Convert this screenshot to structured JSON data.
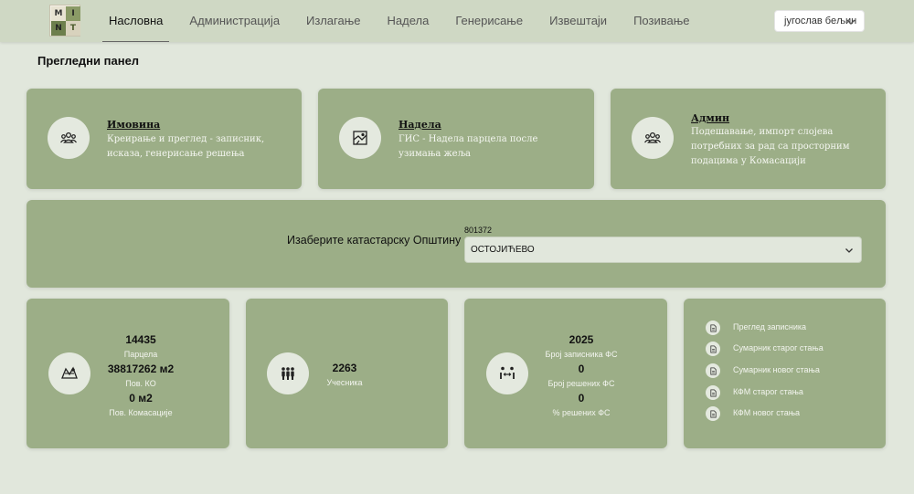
{
  "nav": {
    "logo_letters": [
      "M",
      "I",
      "T",
      "N"
    ],
    "items": [
      {
        "label": "Насловна",
        "active": true
      },
      {
        "label": "Администрација",
        "active": false
      },
      {
        "label": "Излагање",
        "active": false
      },
      {
        "label": "Надела",
        "active": false
      },
      {
        "label": "Генерисање",
        "active": false
      },
      {
        "label": "Извештаји",
        "active": false
      },
      {
        "label": "Позивање",
        "active": false
      }
    ],
    "user": "југослав бељин",
    "user_icon": "chevron-down-icon"
  },
  "page_title": "Прегледни панел",
  "modules": [
    {
      "title": "Имовина",
      "desc": "Креирање и преглед - записник, исказа, генерисање решења",
      "icon": "users-group-icon"
    },
    {
      "title": "Надела",
      "desc": "ГИС - Надела парцела после узимања жеља",
      "icon": "map-icon"
    },
    {
      "title": "Админ",
      "desc": "Подешавање, импорт слојева потребних за рад са просторним подацима у Комасацији",
      "icon": "users-group-icon"
    }
  ],
  "municipality": {
    "label": "Изаберите катастарску Општину",
    "code": "801372",
    "selected": "ОСТОЈИЋЕВО"
  },
  "stats": {
    "parcels": {
      "value": "14435",
      "label": "Парцела"
    },
    "area_ko": {
      "value": "38817262 м2",
      "label": "Пов. КО"
    },
    "area_kom": {
      "value": "0 м2",
      "label": "Пов. Комасације"
    },
    "participants": {
      "value": "2263",
      "label": "Учесника"
    },
    "fs_records": {
      "value": "2025",
      "label": "Број записника ФС"
    },
    "fs_solved": {
      "value": "0",
      "label": "Број решених ФС"
    },
    "fs_percent": {
      "value": "0",
      "label": "% решених ФС"
    }
  },
  "reports": [
    "Преглед записника",
    "Сумарник старог стања",
    "Сумарник новог стања",
    "КФМ старог стања",
    "КФМ новог стања"
  ],
  "colors": {
    "background": "#e1e7dc",
    "navbar": "#cfd8c4",
    "card": "#9cae87",
    "icon_circle": "#e4e9df"
  }
}
